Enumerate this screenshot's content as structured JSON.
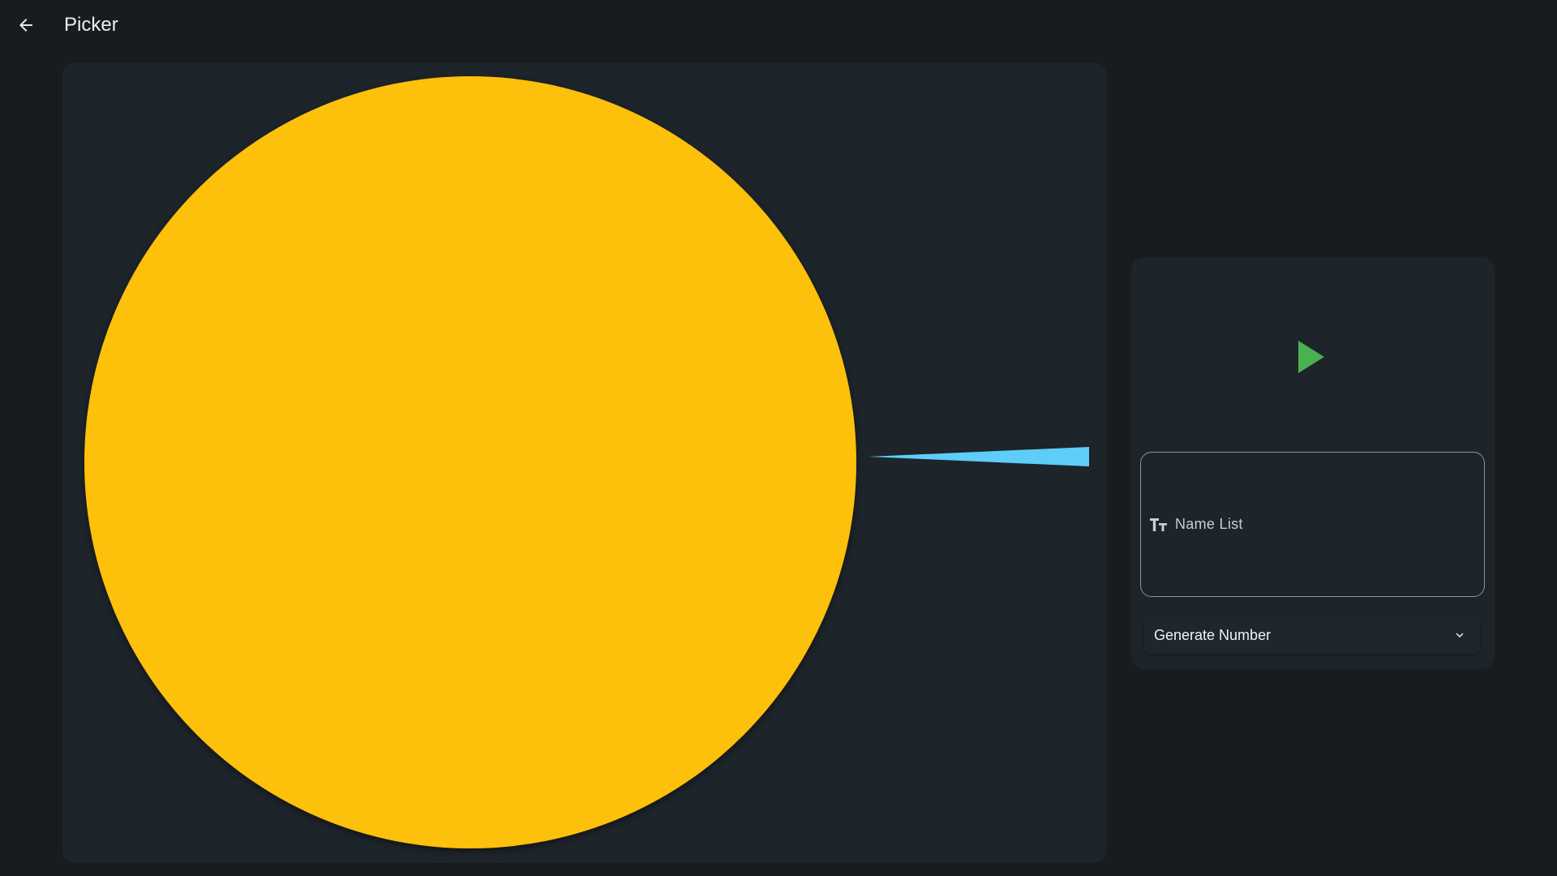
{
  "app_bar": {
    "back_icon": "arrow-left-icon",
    "title": "Picker"
  },
  "wheel": {
    "segment_color": "#fdc00b",
    "pointer_color": "#5ecdf9",
    "pointer_icon": "wedge-pointer-icon"
  },
  "controls": {
    "play_icon": "play-icon",
    "play_color": "#4caf50",
    "name_field": {
      "icon": "text-size-icon",
      "placeholder": "Name List",
      "value": ""
    },
    "mode_select": {
      "selected": "Generate Number",
      "icon": "chevron-down-icon"
    }
  },
  "colors": {
    "background": "#181c1f",
    "card": "#1d242a",
    "field_border": "#8a959c"
  }
}
